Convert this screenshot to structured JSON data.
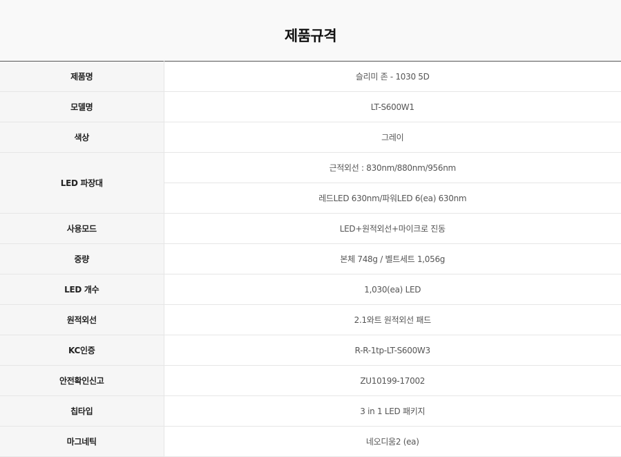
{
  "title": "제품규격",
  "rows": [
    {
      "label": "제품명",
      "value": "슬리미 존 - 1030 5D"
    },
    {
      "label": "모델명",
      "value": "LT-S600W1"
    },
    {
      "label": "색상",
      "value": "그레이"
    },
    {
      "label": "LED 파장대",
      "values": [
        "근적외선 : 830nm/880nm/956nm",
        "레드LED 630nm/파워LED 6(ea) 630nm"
      ]
    },
    {
      "label": "사용모드",
      "value": "LED+원적외선+마이크로 진동"
    },
    {
      "label": "중량",
      "value": "본체 748g / 벨트세트 1,056g"
    },
    {
      "label": "LED 개수",
      "value": "1,030(ea) LED"
    },
    {
      "label": "원적외선",
      "value": "2.1와트 원적외선 패드"
    },
    {
      "label": "KC인증",
      "value": "R-R-1tp-LT-S600W3"
    },
    {
      "label": "안전확인신고",
      "value": "ZU10199-17002"
    },
    {
      "label": "칩타입",
      "value": "3 in 1 LED 패키지"
    },
    {
      "label": "마그네틱",
      "value": "네오디움2 (ea)"
    }
  ]
}
